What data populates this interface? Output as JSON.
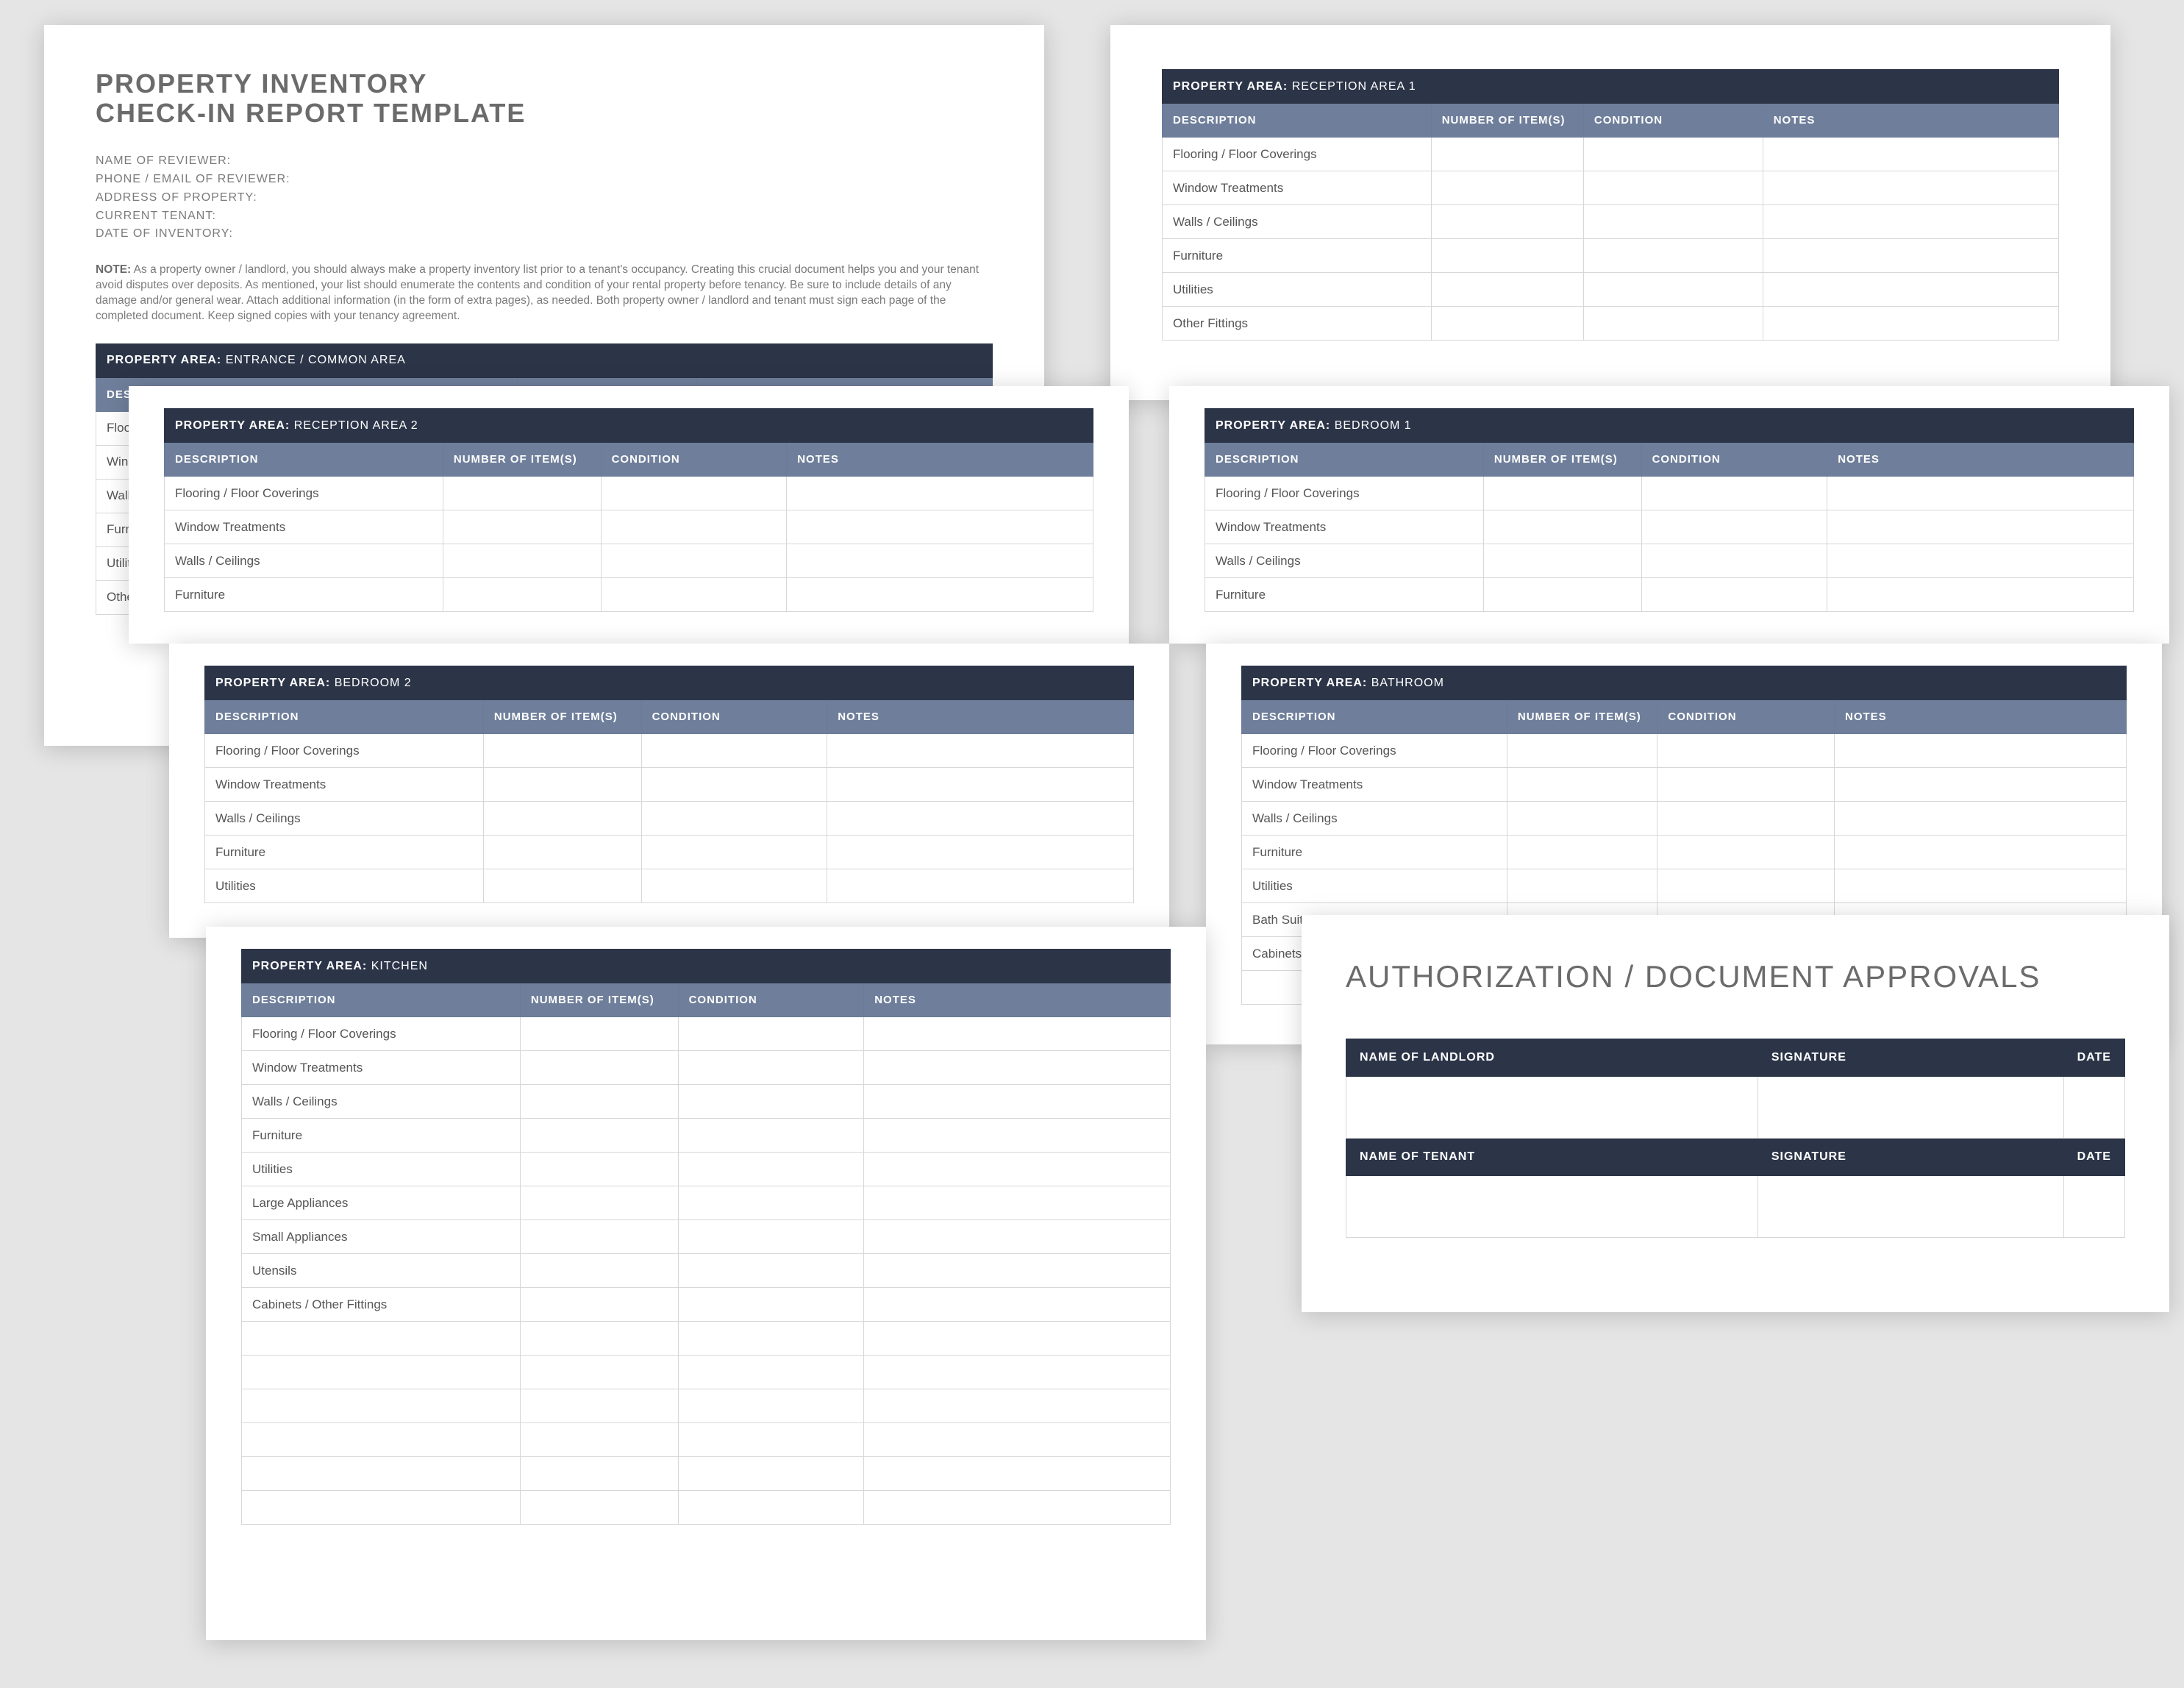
{
  "title_line1": "PROPERTY INVENTORY",
  "title_line2": "CHECK-IN REPORT TEMPLATE",
  "meta": {
    "reviewer_name": "NAME OF REVIEWER:",
    "reviewer_contact": "PHONE / EMAIL OF REVIEWER:",
    "address": "ADDRESS OF PROPERTY:",
    "tenant": "CURRENT TENANT:",
    "date": "DATE OF INVENTORY:"
  },
  "note_label": "NOTE:",
  "note_text": "As a property owner / landlord, you should always make a property inventory list prior to a tenant's occupancy. Creating this crucial document helps you and your tenant avoid disputes over deposits. As mentioned, your list should enumerate the contents and condition of your rental property before tenancy. Be sure to include details of any damage and/or general wear. Attach additional information (in the form of extra pages), as needed. Both property owner / landlord and tenant must sign each page of the completed document. Keep signed copies with your tenancy agreement.",
  "col": {
    "desc": "DESCRIPTION",
    "num": "NUMBER OF ITEM(S)",
    "cond": "CONDITION",
    "notes": "NOTES"
  },
  "area_label": "PROPERTY AREA:",
  "rows_basic": [
    "Flooring / Floor Coverings",
    "Window Treatments",
    "Walls / Ceilings",
    "Furniture",
    "Utilities",
    "Other Fittings"
  ],
  "rows_bathroom": [
    "Flooring / Floor Coverings",
    "Window Treatments",
    "Walls / Ceilings",
    "Furniture",
    "Utilities",
    "Bath Suite",
    "Cabinets / Other Fittings"
  ],
  "rows_kitchen": [
    "Flooring / Floor Coverings",
    "Window Treatments",
    "Walls / Ceilings",
    "Furniture",
    "Utilities",
    "Large Appliances",
    "Small Appliances",
    "Utensils",
    "Cabinets / Other Fittings"
  ],
  "areas": {
    "entrance": "ENTRANCE / COMMON AREA",
    "reception1": "RECEPTION AREA 1",
    "reception2": "RECEPTION AREA 2",
    "bedroom1": "BEDROOM 1",
    "bedroom2": "BEDROOM 2",
    "bathroom": "BATHROOM",
    "kitchen": "KITCHEN"
  },
  "auth_title": "AUTHORIZATION / DOCUMENT APPROVALS",
  "sig": {
    "landlord": "NAME OF LANDLORD",
    "tenant": "NAME OF TENANT",
    "signature": "SIGNATURE",
    "date": "DATE"
  }
}
